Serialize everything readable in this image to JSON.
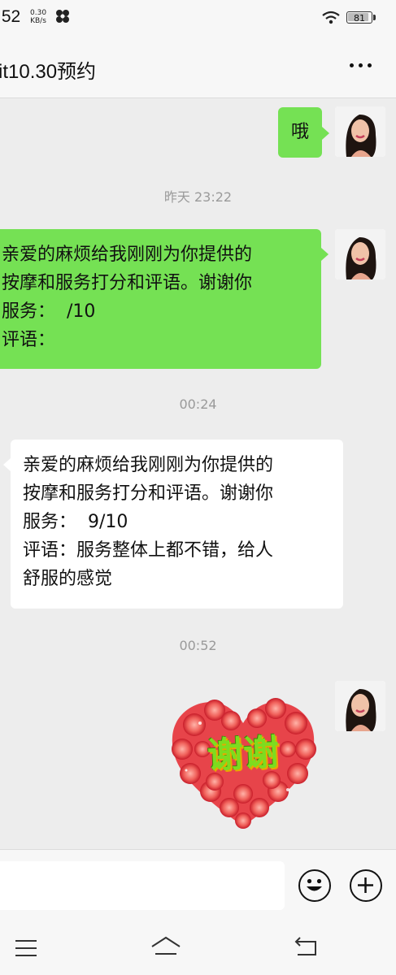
{
  "status_bar": {
    "time": ":52",
    "net_speed_value": "0.30",
    "net_speed_unit": "KB/s",
    "battery": "81"
  },
  "header": {
    "title": "it10.30预约",
    "more_icon": "more-horizontal-icon"
  },
  "messages": [
    {
      "kind": "text",
      "side": "right",
      "lines": [
        "哦"
      ]
    },
    {
      "kind": "timestamp",
      "text": "昨天 23:22"
    },
    {
      "kind": "text",
      "side": "right",
      "lines": [
        "亲爱的麻烦给我刚刚为你提供的",
        "按摩和服务打分和评语。谢谢你",
        "服务：  /10",
        "评语："
      ]
    },
    {
      "kind": "timestamp",
      "text": "00:24"
    },
    {
      "kind": "text",
      "side": "left",
      "lines": [
        "亲爱的麻烦给我刚刚为你提供的",
        "按摩和服务打分和评语。谢谢你",
        "服务：  9/10",
        "评语：服务整体上都不错，给人",
        "舒服的感觉"
      ]
    },
    {
      "kind": "timestamp",
      "text": "00:52"
    },
    {
      "kind": "sticker",
      "side": "right",
      "text": "谢谢",
      "icon": "heart-roses-sticker"
    }
  ],
  "input_bar": {
    "emoji_icon": "emoji-icon",
    "plus_icon": "plus-icon"
  },
  "nav_bar": {
    "menu_icon": "menu-icon",
    "home_icon": "home-icon",
    "back_icon": "back-icon"
  },
  "colors": {
    "sent_bubble": "#75e154",
    "received_bubble": "#ffffff",
    "background": "#ededed"
  }
}
